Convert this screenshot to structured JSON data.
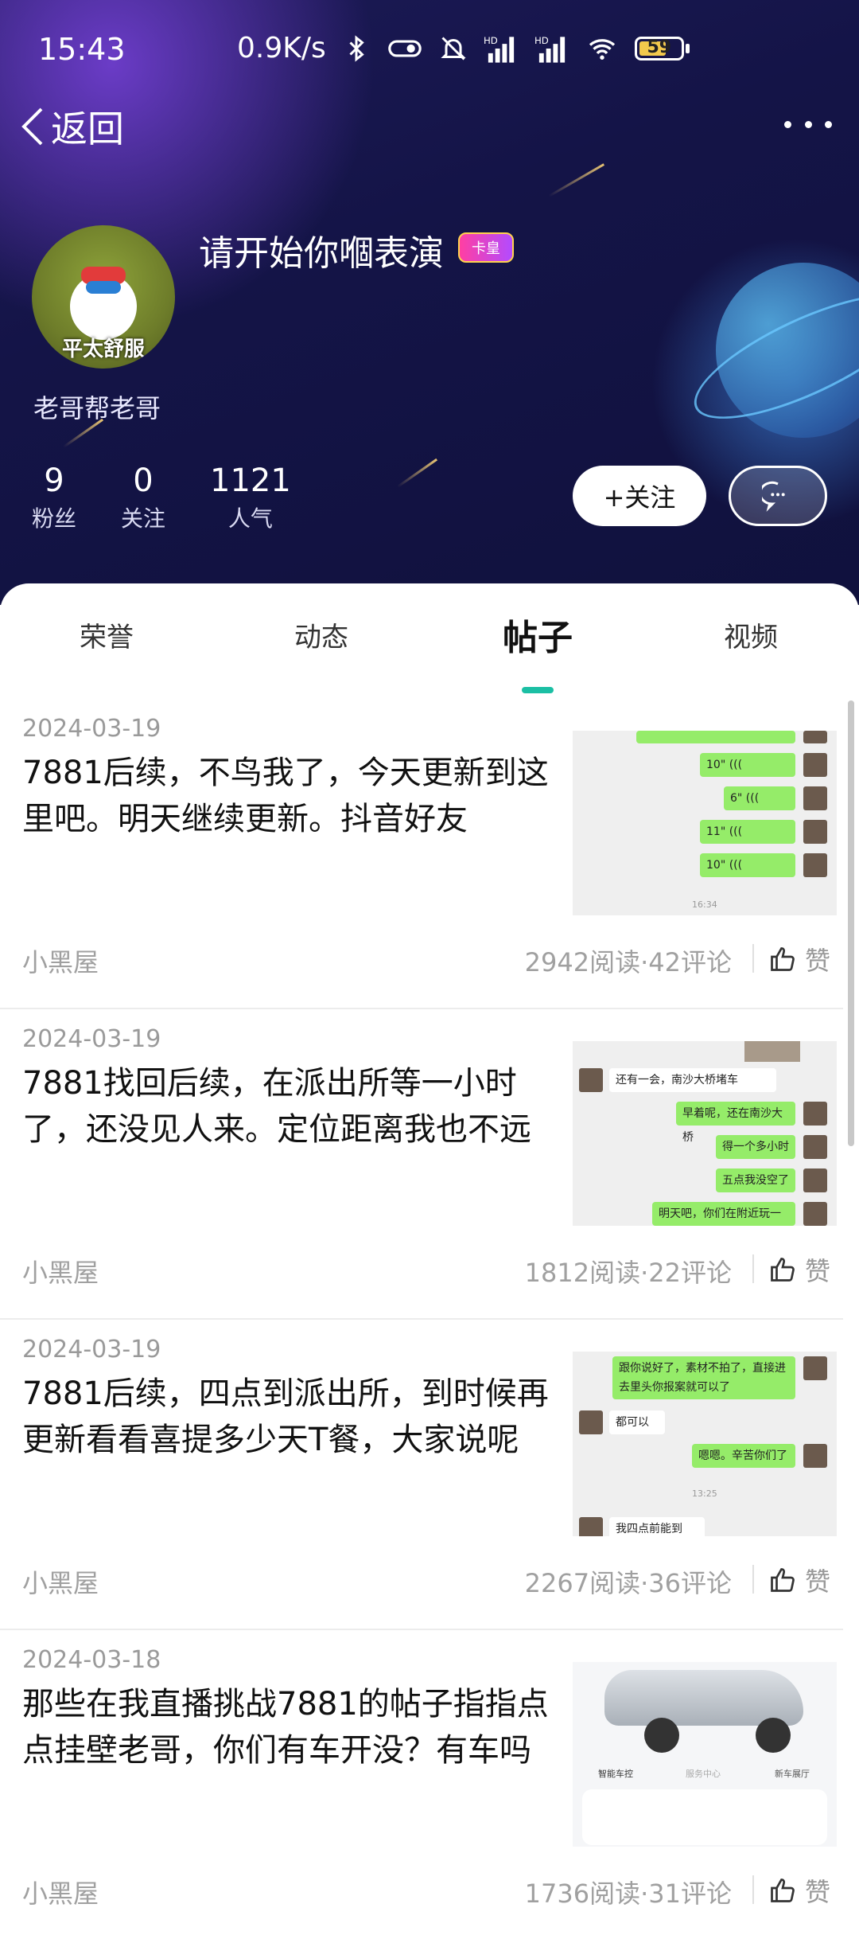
{
  "status_bar": {
    "time": "15:43",
    "network_speed": "0.9K/s",
    "battery_level": "59",
    "icons": [
      "bluetooth-icon",
      "vibrate-icon",
      "mute-icon",
      "signal-hd-icon",
      "signal-hd-icon",
      "wifi-icon",
      "battery-icon"
    ]
  },
  "nav": {
    "back_label": "返回",
    "more_icon": "more-dots-icon"
  },
  "profile": {
    "avatar_text": "平太舒服",
    "username": "请开始你嗰表演",
    "badge": "卡皇",
    "signature": "老哥帮老哥",
    "stats": [
      {
        "value": "9",
        "label": "粉丝"
      },
      {
        "value": "0",
        "label": "关注"
      },
      {
        "value": "1121",
        "label": "人气"
      }
    ],
    "follow_label": "+关注",
    "message_icon": "chat-bubble-icon"
  },
  "tabs": [
    {
      "label": "荣誉",
      "active": false
    },
    {
      "label": "动态",
      "active": false
    },
    {
      "label": "帖子",
      "active": true
    },
    {
      "label": "视频",
      "active": false
    }
  ],
  "posts": [
    {
      "date": "2024-03-19",
      "title": "7881后续，不鸟我了，今天更新到这里吧。明天继续更新。抖音好友",
      "forum": "小黑屋",
      "stats": "2942阅读·42评论",
      "like_label": "赞",
      "thumb": {
        "time": "16:34",
        "bubbles": [
          "10\" (((",
          "6\" (((",
          "11\" (((",
          "10\" ((("
        ]
      }
    },
    {
      "date": "2024-03-19",
      "title": "7881找回后续，在派出所等一小时了，还没见人来。定位距离我也不远",
      "forum": "小黑屋",
      "stats": "1812阅读·22评论",
      "like_label": "赞",
      "thumb": {
        "bubbles": [
          "还有一会，南沙大桥堵车",
          "早着呢，还在南沙大桥",
          "得一个多小时",
          "五点我没空了",
          "明天吧，你们在附近玩一下"
        ]
      }
    },
    {
      "date": "2024-03-19",
      "title": "7881后续，四点到派出所，到时候再更新看看喜提多少天T餐，大家说呢",
      "forum": "小黑屋",
      "stats": "2267阅读·36评论",
      "like_label": "赞",
      "thumb": {
        "time": "13:25",
        "bubbles": [
          "跟你说好了，素材不拍了，直接进去里头你报案就可以了",
          "都可以",
          "嗯嗯。辛苦你们了",
          "我四点前能到"
        ]
      }
    },
    {
      "date": "2024-03-18",
      "title": "那些在我直播挑战7881的帖子指指点点挂壁老哥，你们有车开没？有车吗",
      "forum": "小黑屋",
      "stats": "1736阅读·31评论",
      "like_label": "赞",
      "thumb": {
        "tabs": [
          "智能车控",
          "服务中心",
          "新车展厅"
        ]
      }
    }
  ]
}
